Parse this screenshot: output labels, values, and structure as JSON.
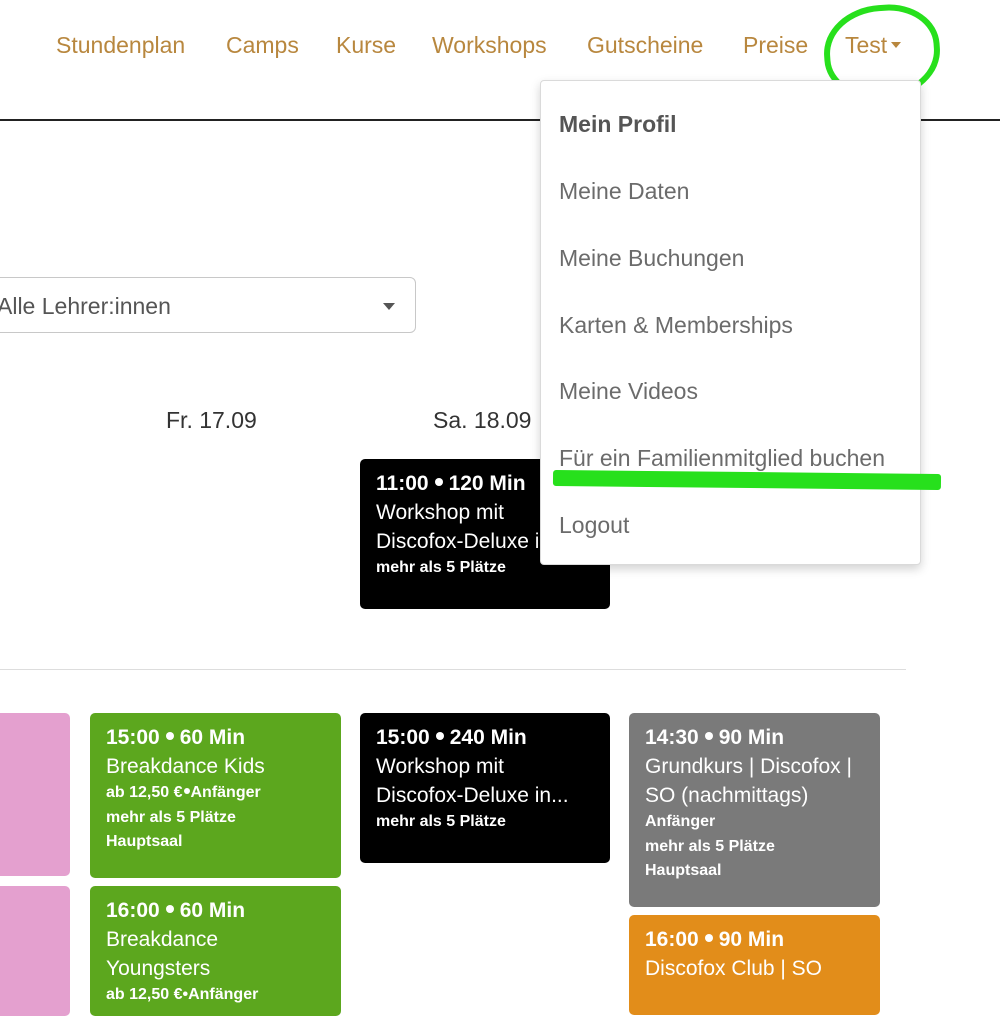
{
  "nav": {
    "items": [
      "Stundenplan",
      "Camps",
      "Kurse",
      "Workshops",
      "Gutscheine",
      "Preise"
    ],
    "user_label": "Test"
  },
  "filter": {
    "teacher_value": "Alle Lehrer:innen"
  },
  "days": {
    "fri": "Fr. 17.09",
    "sat": "Sa. 18.09"
  },
  "user_menu": {
    "header": "Mein Profil",
    "items": [
      "Meine Daten",
      "Meine Buchungen",
      "Karten & Memberships",
      "Meine Videos",
      "Für ein Familienmitglied buchen",
      "Logout"
    ]
  },
  "cards": {
    "ws1": {
      "time": "11:00",
      "duration": "120 Min",
      "title_1": "Workshop mit",
      "title_2": "Discofox-Deluxe in",
      "spots": "mehr als 5 Plätze"
    },
    "bk": {
      "time": "15:00",
      "duration": "60 Min",
      "title": "Breakdance Kids",
      "price": "ab 12,50 €",
      "level": "Anfänger",
      "spots": "mehr als 5 Plätze",
      "room": "Hauptsaal"
    },
    "ws2": {
      "time": "15:00",
      "duration": "240 Min",
      "title_1": "Workshop mit",
      "title_2": "Discofox-Deluxe in...",
      "spots": "mehr als 5 Plätze"
    },
    "gk": {
      "time": "14:30",
      "duration": "90 Min",
      "title_1": "Grundkurs | Discofox |",
      "title_2": "SO (nachmittags)",
      "level": "Anfänger",
      "spots": "mehr als 5 Plätze",
      "room": "Hauptsaal"
    },
    "by": {
      "time": "16:00",
      "duration": "60 Min",
      "title_1": "Breakdance",
      "title_2": "Youngsters",
      "price_line": "ab 12,50 €•Anfänger"
    },
    "dc": {
      "time": "16:00",
      "duration": "90 Min",
      "title": "Discofox Club | SO"
    }
  },
  "colors": {
    "nav_link": "#b8873e",
    "annotation": "#27e01c",
    "green": "#5ca71e",
    "gray": "#7a7a7a",
    "orange": "#e28d1a",
    "pink": "#e4a0cf"
  }
}
